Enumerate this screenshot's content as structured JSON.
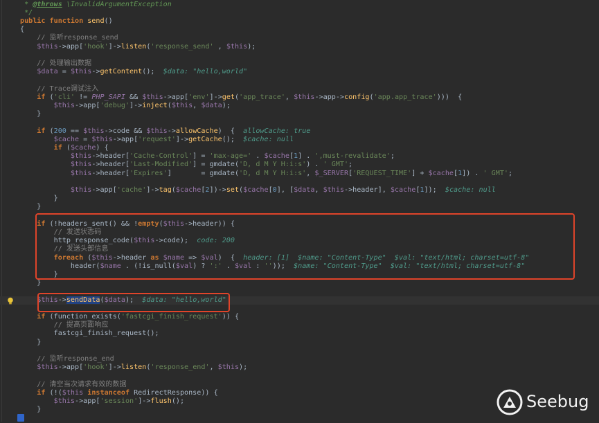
{
  "editor": {
    "lines": [
      [
        [
          "doc",
          " * "
        ],
        [
          "tag",
          "@throws"
        ],
        [
          "doc",
          " \\InvalidArgumentException"
        ]
      ],
      [
        [
          "doc",
          " */"
        ]
      ],
      [
        [
          "kw",
          "public function "
        ],
        [
          "fn",
          "send"
        ],
        [
          "",
          "()"
        ]
      ],
      [
        [
          "",
          "{"
        ]
      ],
      [
        [
          "cm",
          "    // 监听response_send"
        ]
      ],
      [
        [
          "var",
          "    $this"
        ],
        [
          "",
          "->app["
        ],
        [
          "str",
          "'hook'"
        ],
        [
          "",
          "]->"
        ],
        [
          "fn",
          "listen"
        ],
        [
          "",
          "("
        ],
        [
          "str",
          "'response_send'"
        ],
        [
          "",
          " , "
        ],
        [
          "var",
          "$this"
        ],
        [
          "",
          ");"
        ]
      ],
      [
        [
          "",
          ""
        ]
      ],
      [
        [
          "cm",
          "    // 处理输出数据"
        ]
      ],
      [
        [
          "var",
          "    $data"
        ],
        [
          "",
          " = "
        ],
        [
          "var",
          "$this"
        ],
        [
          "",
          "->"
        ],
        [
          "fn",
          "getContent"
        ],
        [
          "",
          "();  "
        ],
        [
          "hint",
          "$data: \"hello,world\""
        ]
      ],
      [
        [
          "",
          ""
        ]
      ],
      [
        [
          "cm",
          "    // Trace调试注入"
        ]
      ],
      [
        [
          "kw",
          "    if "
        ],
        [
          "",
          "("
        ],
        [
          "str",
          "'cli'"
        ],
        [
          "",
          " != "
        ],
        [
          "constant",
          "PHP_SAPI"
        ],
        [
          "",
          " && "
        ],
        [
          "var",
          "$this"
        ],
        [
          "",
          "->app["
        ],
        [
          "str",
          "'env'"
        ],
        [
          "",
          "]->"
        ],
        [
          "fn",
          "get"
        ],
        [
          "",
          "("
        ],
        [
          "str",
          "'app_trace'"
        ],
        [
          "",
          ", "
        ],
        [
          "var",
          "$this"
        ],
        [
          "",
          "->app->"
        ],
        [
          "fn",
          "config"
        ],
        [
          "",
          "("
        ],
        [
          "str",
          "'app.app_trace'"
        ],
        [
          "",
          ")))  {"
        ]
      ],
      [
        [
          "var",
          "        $this"
        ],
        [
          "",
          "->app["
        ],
        [
          "str",
          "'debug'"
        ],
        [
          "",
          "]->"
        ],
        [
          "fn",
          "inject"
        ],
        [
          "",
          "("
        ],
        [
          "var",
          "$this"
        ],
        [
          "",
          ", "
        ],
        [
          "var",
          "$data"
        ],
        [
          "",
          ");"
        ]
      ],
      [
        [
          "",
          "    }"
        ]
      ],
      [
        [
          "",
          ""
        ]
      ],
      [
        [
          "kw",
          "    if "
        ],
        [
          "",
          "("
        ],
        [
          "num",
          "200"
        ],
        [
          "",
          " == "
        ],
        [
          "var",
          "$this"
        ],
        [
          "",
          "->code && "
        ],
        [
          "var",
          "$this"
        ],
        [
          "",
          "->"
        ],
        [
          "fn",
          "allowCache"
        ],
        [
          "",
          ")  {  "
        ],
        [
          "hint",
          "allowCache: true"
        ]
      ],
      [
        [
          "var",
          "        $cache"
        ],
        [
          "",
          " = "
        ],
        [
          "var",
          "$this"
        ],
        [
          "",
          "->app["
        ],
        [
          "str",
          "'request'"
        ],
        [
          "",
          "]->"
        ],
        [
          "fn",
          "getCache"
        ],
        [
          "",
          "();  "
        ],
        [
          "hint",
          "$cache: null"
        ]
      ],
      [
        [
          "kw",
          "        if "
        ],
        [
          "",
          "("
        ],
        [
          "var",
          "$cache"
        ],
        [
          "",
          ") {"
        ]
      ],
      [
        [
          "var",
          "            $this"
        ],
        [
          "",
          "->header["
        ],
        [
          "str",
          "'Cache-Control'"
        ],
        [
          "",
          "] = "
        ],
        [
          "str",
          "'max-age='"
        ],
        [
          "",
          " . "
        ],
        [
          "var",
          "$cache"
        ],
        [
          "",
          "["
        ],
        [
          "num",
          "1"
        ],
        [
          "",
          "] . "
        ],
        [
          "str",
          "',must-revalidate'"
        ],
        [
          "",
          ";"
        ]
      ],
      [
        [
          "var",
          "            $this"
        ],
        [
          "",
          "->header["
        ],
        [
          "str",
          "'Last-Modified'"
        ],
        [
          "",
          "] = gmdate("
        ],
        [
          "str",
          "'D, d M Y H:i:s'"
        ],
        [
          "",
          ") . "
        ],
        [
          "str",
          "' GMT'"
        ],
        [
          "",
          ";"
        ]
      ],
      [
        [
          "var",
          "            $this"
        ],
        [
          "",
          "->header["
        ],
        [
          "str",
          "'Expires'"
        ],
        [
          "",
          "]       = gmdate("
        ],
        [
          "str",
          "'D, d M Y H:i:s'"
        ],
        [
          "",
          ", "
        ],
        [
          "var",
          "$_SERVER"
        ],
        [
          "",
          "["
        ],
        [
          "str",
          "'REQUEST_TIME'"
        ],
        [
          "",
          "] + "
        ],
        [
          "var",
          "$cache"
        ],
        [
          "",
          "["
        ],
        [
          "num",
          "1"
        ],
        [
          "",
          "]) . "
        ],
        [
          "str",
          "' GMT'"
        ],
        [
          "",
          ";"
        ]
      ],
      [
        [
          "",
          ""
        ]
      ],
      [
        [
          "var",
          "            $this"
        ],
        [
          "",
          "->app["
        ],
        [
          "str",
          "'cache'"
        ],
        [
          "",
          "]->"
        ],
        [
          "fn",
          "tag"
        ],
        [
          "",
          "("
        ],
        [
          "var",
          "$cache"
        ],
        [
          "",
          "["
        ],
        [
          "num",
          "2"
        ],
        [
          "",
          "])->"
        ],
        [
          "fn",
          "set"
        ],
        [
          "",
          "("
        ],
        [
          "var",
          "$cache"
        ],
        [
          "",
          "["
        ],
        [
          "num",
          "0"
        ],
        [
          "",
          "], ["
        ],
        [
          "var",
          "$data"
        ],
        [
          "",
          ", "
        ],
        [
          "var",
          "$this"
        ],
        [
          "",
          "->header], "
        ],
        [
          "var",
          "$cache"
        ],
        [
          "",
          "["
        ],
        [
          "num",
          "1"
        ],
        [
          "",
          "]);  "
        ],
        [
          "hint",
          "$cache: null"
        ]
      ],
      [
        [
          "",
          "        }"
        ]
      ],
      [
        [
          "",
          "    }"
        ]
      ],
      [
        [
          "",
          ""
        ]
      ],
      [
        [
          "kw",
          "    if "
        ],
        [
          "",
          "(!headers_sent() && !"
        ],
        [
          "kw",
          "empty"
        ],
        [
          "",
          "("
        ],
        [
          "var",
          "$this"
        ],
        [
          "",
          "->header)) {"
        ]
      ],
      [
        [
          "cm",
          "        // 发送状态码"
        ]
      ],
      [
        [
          "",
          "        http_response_code("
        ],
        [
          "var",
          "$this"
        ],
        [
          "",
          "->code);  "
        ],
        [
          "hint",
          "code: 200"
        ]
      ],
      [
        [
          "cm",
          "        // 发送头部信息"
        ]
      ],
      [
        [
          "kw",
          "        foreach "
        ],
        [
          "",
          "("
        ],
        [
          "var",
          "$this"
        ],
        [
          "",
          "->header "
        ],
        [
          "kw",
          "as "
        ],
        [
          "var",
          "$name"
        ],
        [
          "",
          " => "
        ],
        [
          "var",
          "$val"
        ],
        [
          "",
          ")  {  "
        ],
        [
          "hint",
          "header: [1]  $name: \"Content-Type\"  $val: \"text/html; charset=utf-8\""
        ]
      ],
      [
        [
          "",
          "            header("
        ],
        [
          "var",
          "$name"
        ],
        [
          "",
          " . (!is_null("
        ],
        [
          "var",
          "$val"
        ],
        [
          "",
          ") ? "
        ],
        [
          "str",
          "':'"
        ],
        [
          "",
          " . "
        ],
        [
          "var",
          "$val"
        ],
        [
          "",
          " : "
        ],
        [
          "str",
          "''"
        ],
        [
          "",
          "));  "
        ],
        [
          "hint",
          "$name: \"Content-Type\"  $val: \"text/html; charset=utf-8\""
        ]
      ],
      [
        [
          "",
          "        }"
        ]
      ],
      [
        [
          "",
          "    }"
        ]
      ],
      [
        [
          "",
          ""
        ]
      ],
      [
        [
          "var",
          "    $this"
        ],
        [
          "",
          "->"
        ],
        [
          "fn sel",
          "sendData"
        ],
        [
          "",
          "("
        ],
        [
          "var",
          "$data"
        ],
        [
          "",
          ");  "
        ],
        [
          "hint",
          "$data: \"hello,world\""
        ]
      ],
      [
        [
          "",
          ""
        ]
      ],
      [
        [
          "kw",
          "    if "
        ],
        [
          "",
          "(function_exists("
        ],
        [
          "str",
          "'fastcgi_finish_request'"
        ],
        [
          "",
          ")) {"
        ]
      ],
      [
        [
          "cm",
          "        // 提高页面响应"
        ]
      ],
      [
        [
          "",
          "        fastcgi_finish_request();"
        ]
      ],
      [
        [
          "",
          "    }"
        ]
      ],
      [
        [
          "",
          ""
        ]
      ],
      [
        [
          "cm",
          "    // 监听response_end"
        ]
      ],
      [
        [
          "var",
          "    $this"
        ],
        [
          "",
          "->app["
        ],
        [
          "str",
          "'hook'"
        ],
        [
          "",
          "]->"
        ],
        [
          "fn",
          "listen"
        ],
        [
          "",
          "("
        ],
        [
          "str",
          "'response_end'"
        ],
        [
          "",
          ", "
        ],
        [
          "var",
          "$this"
        ],
        [
          "",
          ");"
        ]
      ],
      [
        [
          "",
          ""
        ]
      ],
      [
        [
          "cm",
          "    // 清空当次请求有效的数据"
        ]
      ],
      [
        [
          "kw",
          "    if "
        ],
        [
          "",
          "(!("
        ],
        [
          "var",
          "$this "
        ],
        [
          "kw",
          "instanceof "
        ],
        [
          "cls",
          "RedirectResponse"
        ],
        [
          "",
          ")) {"
        ]
      ],
      [
        [
          "var",
          "        $this"
        ],
        [
          "",
          "->app["
        ],
        [
          "str",
          "'session'"
        ],
        [
          "",
          "]->"
        ],
        [
          "fn",
          "flush"
        ],
        [
          "",
          "();"
        ]
      ],
      [
        [
          "",
          "    }"
        ]
      ],
      [
        [
          "",
          "}"
        ]
      ]
    ]
  },
  "watermark": {
    "text": "Seebug"
  },
  "colors": {
    "highlight_box": "#e0442a",
    "background": "#2b2b2b"
  }
}
